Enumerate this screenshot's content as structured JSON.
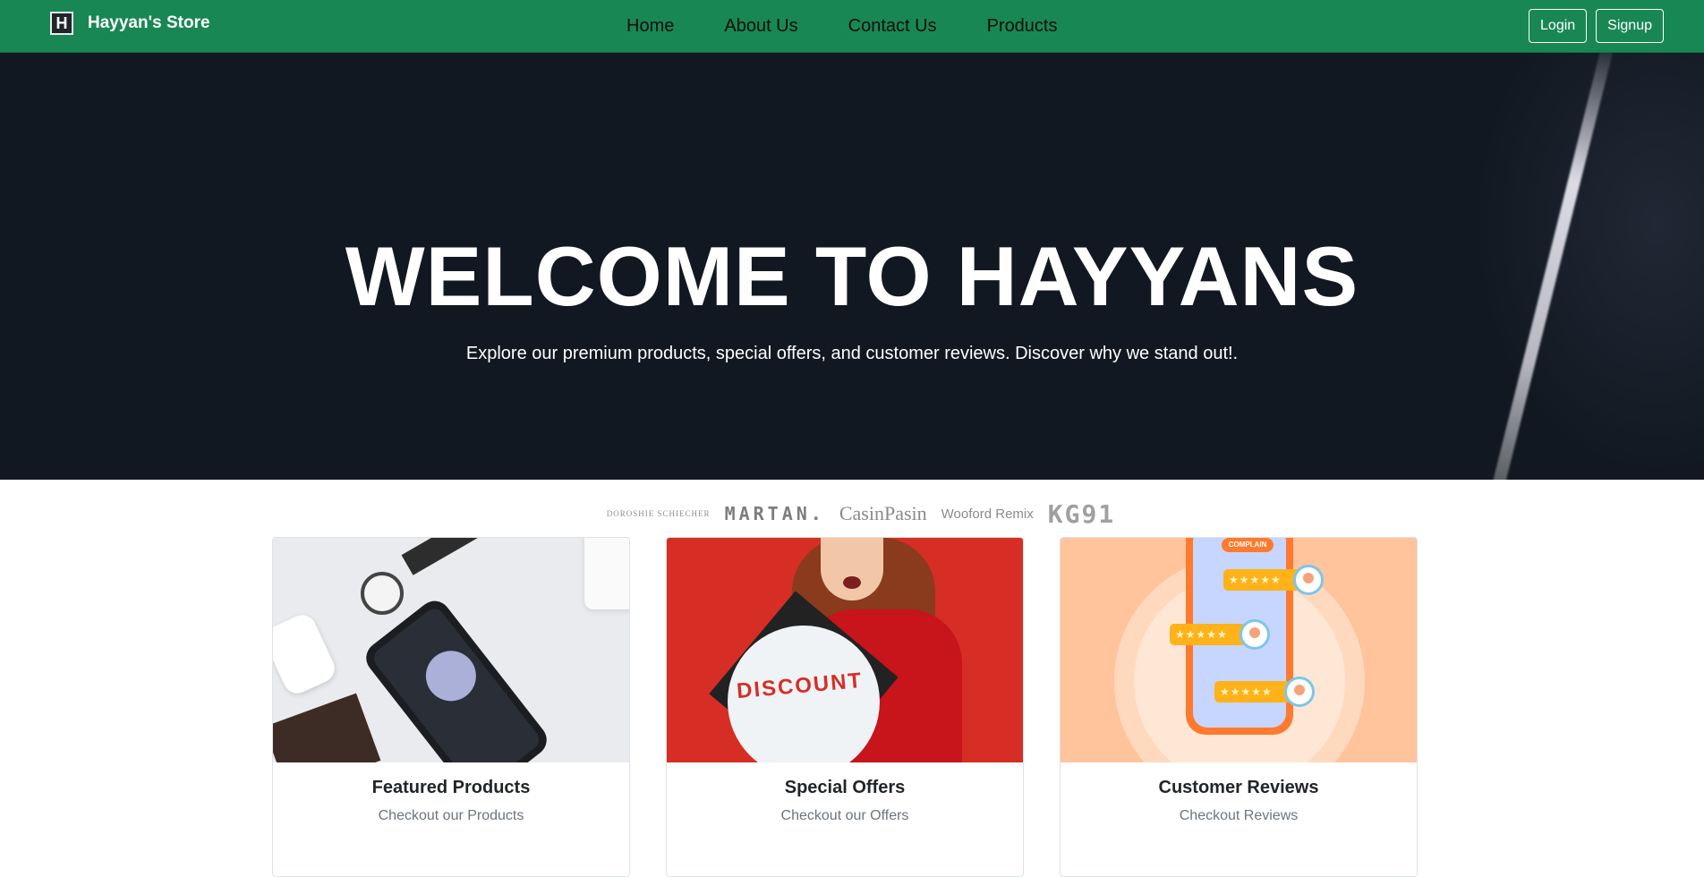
{
  "navbar": {
    "brand_logo": "H",
    "brand_name": "Hayyan's Store",
    "links": [
      "Home",
      "About Us",
      "Contact Us",
      "Products"
    ],
    "login_label": "Login",
    "signup_label": "Signup",
    "colors": {
      "bar": "#198754",
      "link_text": "#0b0f0d"
    }
  },
  "hero": {
    "title": "WELCOME TO HAYYANS",
    "subtitle": "Explore our premium products, special offers, and customer reviews. Discover why we stand out!.",
    "background_color": "#121821"
  },
  "brand_strip": [
    "DOROSHIE SCHIECHER",
    "MARTAN.",
    "CasinPasin",
    "Wooford Remix",
    "KG91"
  ],
  "cards": [
    {
      "title": "Featured Products",
      "text": "Checkout our Products",
      "image_icon": "products-photo"
    },
    {
      "title": "Special Offers",
      "text": "Checkout our Offers",
      "image_icon": "discount-photo",
      "image_label": "DISCOUNT"
    },
    {
      "title": "Customer Reviews",
      "text": "Checkout Reviews",
      "image_icon": "reviews-illustration",
      "image_label": "COMPLAIN",
      "review_stars": [
        "★★★★★",
        "★★★★★",
        "★★★★★"
      ]
    }
  ]
}
